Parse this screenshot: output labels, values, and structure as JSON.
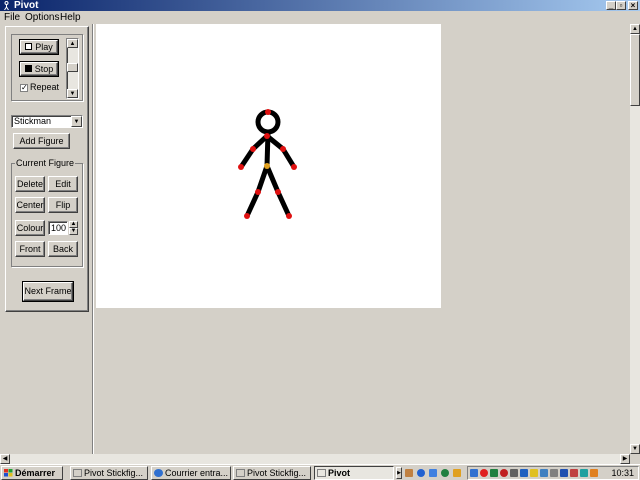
{
  "window": {
    "title": "Pivot"
  },
  "menu": {
    "file": "File",
    "options": "Options",
    "help": "Help"
  },
  "playback": {
    "play": "Play",
    "stop": "Stop",
    "repeat": "Repeat",
    "repeat_checked": true
  },
  "figure_select": {
    "value": "Stickman"
  },
  "add_figure": "Add Figure",
  "current_figure": {
    "label": "Current Figure",
    "delete": "Delete",
    "edit": "Edit",
    "center": "Center",
    "flip": "Flip",
    "colour": "Colour",
    "colour_value": "100",
    "front": "Front",
    "back": "Back"
  },
  "next_frame": "Next Frame",
  "taskbar": {
    "start": "Démarrer",
    "tasks": [
      "Pivot Stickfig...",
      "Courrier entra...",
      "Pivot Stickfig...",
      "Pivot"
    ],
    "clock": "10:31"
  },
  "colors": {
    "joint": "#e01010",
    "pivot_joint": "#e0a020",
    "title_start": "#0a246a",
    "title_end": "#a6caf0"
  }
}
